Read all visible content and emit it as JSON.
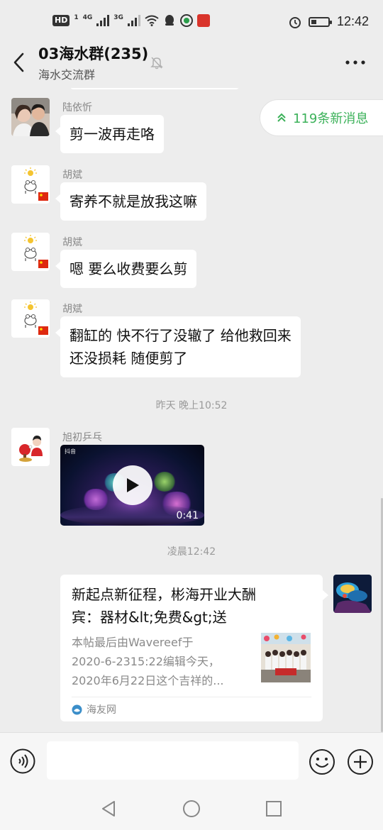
{
  "status_bar": {
    "hd_badge": "HD",
    "sim1": "1",
    "signal1": "4G",
    "signal2": "3G",
    "time": "12:42",
    "battery_level": 0.3
  },
  "header": {
    "title": "03海水群(235)",
    "subtitle": "海水交流群"
  },
  "new_messages": {
    "label": "119条新消息"
  },
  "messages": [
    {
      "sender": "陆依忻",
      "text": "剪一波再走咯"
    },
    {
      "sender": "胡斌",
      "text": "寄养不就是放我这嘛"
    },
    {
      "sender": "胡斌",
      "text": "嗯 要么收费要么剪"
    },
    {
      "sender": "胡斌",
      "lines": [
        "翻缸的 快不行了没辙了 给他救回来",
        "还没损耗 随便剪了"
      ]
    }
  ],
  "timestamps": [
    "昨天 晚上10:52",
    "凌晨12:42"
  ],
  "video_message": {
    "sender": "旭初乒乓",
    "duration": "0:41",
    "watermark": "抖音"
  },
  "link_card": {
    "title_lines": [
      "新起点新征程，彬海开业大酬",
      "宾：器材&lt;免费&gt;送"
    ],
    "desc_lines": [
      "本帖最后由Wavereef于",
      "2020-6-2315:22编辑今天，",
      "2020年6月22日这个吉祥的..."
    ],
    "source": "海友网"
  },
  "colors": {
    "background": "#ededed",
    "bubble": "#ffffff",
    "accent_green": "#3bb159"
  },
  "icons": {
    "back": "chevron-left-icon",
    "mute": "bell-off-icon",
    "more": "more-dots-icon",
    "voice": "voice-icon",
    "emoji": "emoji-icon",
    "plus": "plus-icon"
  }
}
